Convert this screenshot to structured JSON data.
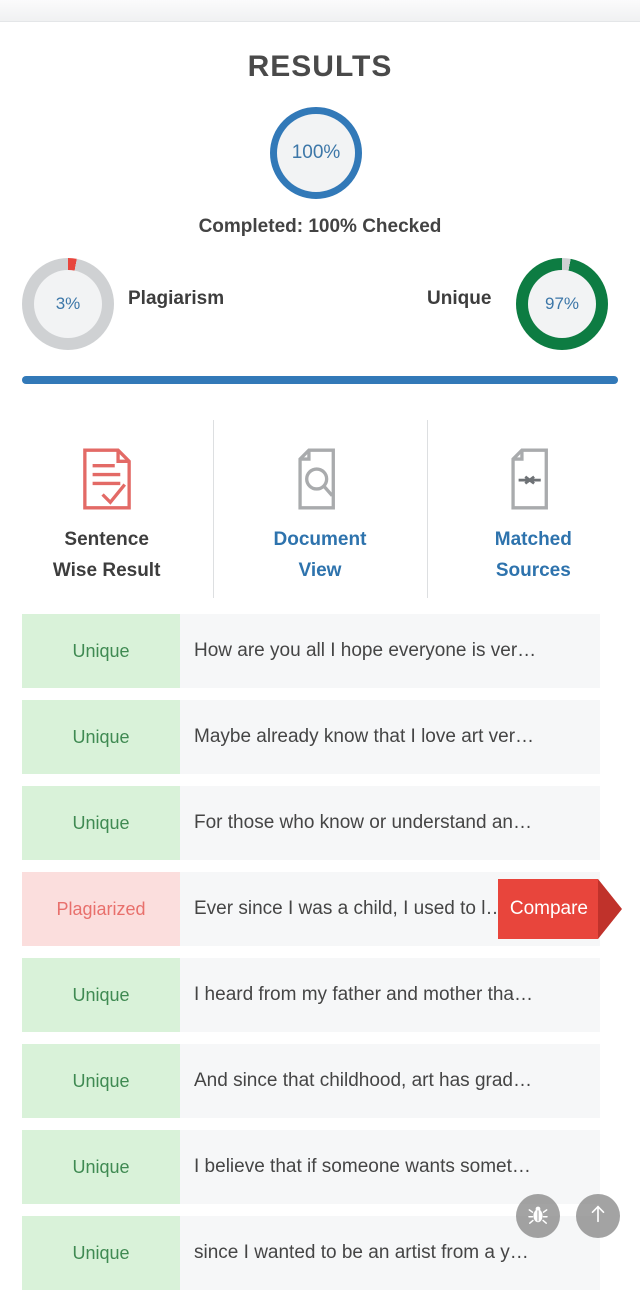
{
  "header": {
    "title": "RESULTS"
  },
  "overall": {
    "ring_value": "100%",
    "completed_text": "Completed: 100% Checked",
    "ring_color": "#3279b8"
  },
  "stats": [
    {
      "value": "3%",
      "label": "Plagiarism",
      "color": "#e8453c",
      "percent": 3
    },
    {
      "value": "97%",
      "label": "Unique",
      "color": "#0d7c42",
      "percent": 97
    }
  ],
  "divider": {
    "color": "#3279b8"
  },
  "tabs": [
    {
      "label_line1": "Sentence",
      "label_line2": "Wise Result",
      "icon": "document-check-icon",
      "active": true,
      "color": "#3d3d3d"
    },
    {
      "label_line1": "Document",
      "label_line2": "View",
      "icon": "document-search-icon",
      "active": false,
      "color": "#2e73ad"
    },
    {
      "label_line1": "Matched",
      "label_line2": "Sources",
      "icon": "document-arrows-icon",
      "active": false,
      "color": "#2e73ad"
    }
  ],
  "sentence_rows": [
    {
      "status": "Unique",
      "type": "unique",
      "text": "How are you all I hope everyone is ver…",
      "compare": null
    },
    {
      "status": "Unique",
      "type": "unique",
      "text": "Maybe already know that I love art ver…",
      "compare": null
    },
    {
      "status": "Unique",
      "type": "unique",
      "text": "For those who know or understand an…",
      "compare": null
    },
    {
      "status": "Plagiarized",
      "type": "plag",
      "text": "Ever since I was a child, I used to l…",
      "compare": "Compare"
    },
    {
      "status": "Unique",
      "type": "unique",
      "text": "I heard from my father and mother tha…",
      "compare": null
    },
    {
      "status": "Unique",
      "type": "unique",
      "text": "And since that childhood, art has grad…",
      "compare": null
    },
    {
      "status": "Unique",
      "type": "unique",
      "text": "I believe that if someone wants somet…",
      "compare": null
    },
    {
      "status": "Unique",
      "type": "unique",
      "text": "since I wanted to be an artist from a y…",
      "compare": null
    }
  ],
  "floating_buttons": [
    {
      "icon": "bug-icon",
      "name": "debug-button"
    },
    {
      "icon": "arrow-up-icon",
      "name": "scroll-to-top-button"
    }
  ]
}
